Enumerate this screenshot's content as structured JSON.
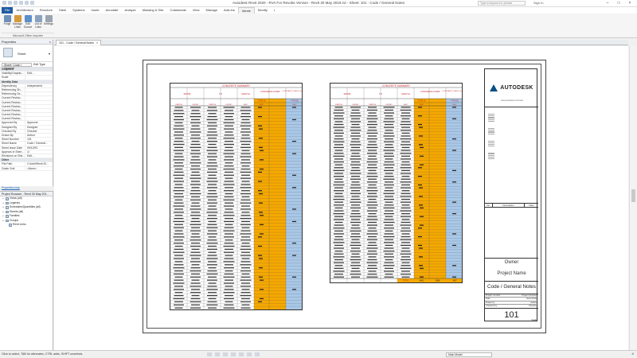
{
  "window": {
    "title": "Autodesk Revit 2020 - RVA For Revoke Version - Revit 30 May 2019.rvt - Sheet: 101 - Code / General Notes",
    "search_placeholder": "Type a keyword or phrase",
    "user": "Sign In"
  },
  "ribbon": {
    "tabs": [
      "File",
      "Architecture",
      "Structure",
      "Steel",
      "Systems",
      "Insert",
      "Annotate",
      "Analyze",
      "Massing & Site",
      "Collaborate",
      "View",
      "Manage",
      "Add-Ins",
      "Ideate",
      "Modify",
      "•"
    ],
    "active_tab": "Ideate",
    "buttons": [
      {
        "label": "Purge",
        "color": "#6e8fb7"
      },
      {
        "label": "Manage Links",
        "color": "#d59a3b"
      },
      {
        "label": "Edit Source",
        "color": "#5b8fc9"
      },
      {
        "label": "List of Links",
        "color": "#8aa2bf"
      },
      {
        "label": "Settings",
        "color": "#9aa5b1"
      }
    ],
    "panel_label": "Microsoft Office Importer"
  },
  "properties": {
    "header": "Properties",
    "type_name": "Sheet",
    "filter_value": "Sheet: Code / General",
    "edit_type": "Edit Type",
    "rows": [
      {
        "k": "Graphics",
        "sec": true
      },
      {
        "k": "Visibility/Graphic...",
        "v": "Edit..."
      },
      {
        "k": "Scale",
        "v": ""
      },
      {
        "k": "Identity Data",
        "sec": true
      },
      {
        "k": "Dependency",
        "v": "Independent"
      },
      {
        "k": "Referencing Sh...",
        "v": ""
      },
      {
        "k": "Referencing De...",
        "v": ""
      },
      {
        "k": "Current Revisio...",
        "v": ""
      },
      {
        "k": "Current Revisio...",
        "v": ""
      },
      {
        "k": "Current Revisio...",
        "v": ""
      },
      {
        "k": "Current Revisio...",
        "v": ""
      },
      {
        "k": "Current Revisio...",
        "v": ""
      },
      {
        "k": "Current Revisio...",
        "v": ""
      },
      {
        "k": "Approved By",
        "v": "Approver"
      },
      {
        "k": "Designed By",
        "v": "Designer"
      },
      {
        "k": "Checked By",
        "v": "Checker"
      },
      {
        "k": "Drawn By",
        "v": "Author"
      },
      {
        "k": "Sheet Number",
        "v": "101"
      },
      {
        "k": "Sheet Name",
        "v": "Code / General..."
      },
      {
        "k": "Sheet Issue Date",
        "v": "09/12/92"
      },
      {
        "k": "Appears In Shee...",
        "v": "☑"
      },
      {
        "k": "Revisions on She...",
        "v": "Edit..."
      },
      {
        "k": "Other",
        "sec": true
      },
      {
        "k": "File Path",
        "v": "C:\\Intel\\Revit 20..."
      },
      {
        "k": "Guide Grid",
        "v": "<None>"
      }
    ],
    "help_link": "Properties help",
    "apply": "Apply"
  },
  "browser": {
    "header": "Project Browser - Revit 30 May 201...",
    "items": [
      {
        "label": "Views (all)",
        "expand": "+"
      },
      {
        "label": "Legends",
        "expand": "+"
      },
      {
        "label": "Schedules/Quantities (all)",
        "expand": "+"
      },
      {
        "label": "Sheets (all)",
        "expand": "+"
      },
      {
        "label": "Families",
        "expand": "+"
      },
      {
        "label": "Groups",
        "expand": "+"
      },
      {
        "label": "Revit Links",
        "expand": ""
      }
    ]
  },
  "view_tab": {
    "label": "101 - Code / General Notes",
    "close": "×"
  },
  "schedule_left": {
    "title": "CONCRETE SUMMARY",
    "col_from": "FROM",
    "col_to": "TO",
    "col_len": "LENGTH",
    "col_curb": "CONCRETE CURB",
    "col_gut": "CONCRETE CURB & GUTTER",
    "sub_a": "TYPE A6",
    "sub_b": "TYPE B1",
    "sub_cols": [
      "STATION",
      "OFFSET",
      "STATION",
      "OFFSET",
      "FEET",
      "FEET",
      "FEET"
    ],
    "rows": 66
  },
  "schedule_right": {
    "title": "CONCRETE SUMMARY",
    "col_from": "FROM",
    "col_to": "TO",
    "col_len": "LENGTH",
    "col_curb": "CONCRETE CURB",
    "col_gut": "CONCRETE CURB & GUTTER",
    "sub_a": "TYPE A6",
    "sub_b": "TYPE B1",
    "sub_cols": [
      "STATION",
      "OFFSET",
      "STATION",
      "OFFSET",
      "FEET",
      "FEET",
      "FEET"
    ],
    "rows": 60,
    "total_label": "TOTAL",
    "totals": [
      "8461",
      "1868",
      "1457"
    ]
  },
  "title_block": {
    "brand": "AUTODESK",
    "brand_sub": "www.autodesk.com/revit",
    "rev_headers": [
      "No.",
      "Description",
      "Date"
    ],
    "owner": "Owner",
    "project_name": "Project Name",
    "sheet_name": "Code / General Notes",
    "meta": [
      {
        "k": "Project number",
        "v": "Project Number"
      },
      {
        "k": "Date",
        "v": "Issue Date"
      },
      {
        "k": "Drawn by",
        "v": "Author"
      },
      {
        "k": "Checked by",
        "v": "Checker"
      }
    ],
    "sheet_number": "101",
    "scale": "Scale"
  },
  "status": {
    "message": "Click to select, TAB for alternates, CTRL adds, SHIFT unselects.",
    "model": "Main Model",
    "right": " :0"
  }
}
